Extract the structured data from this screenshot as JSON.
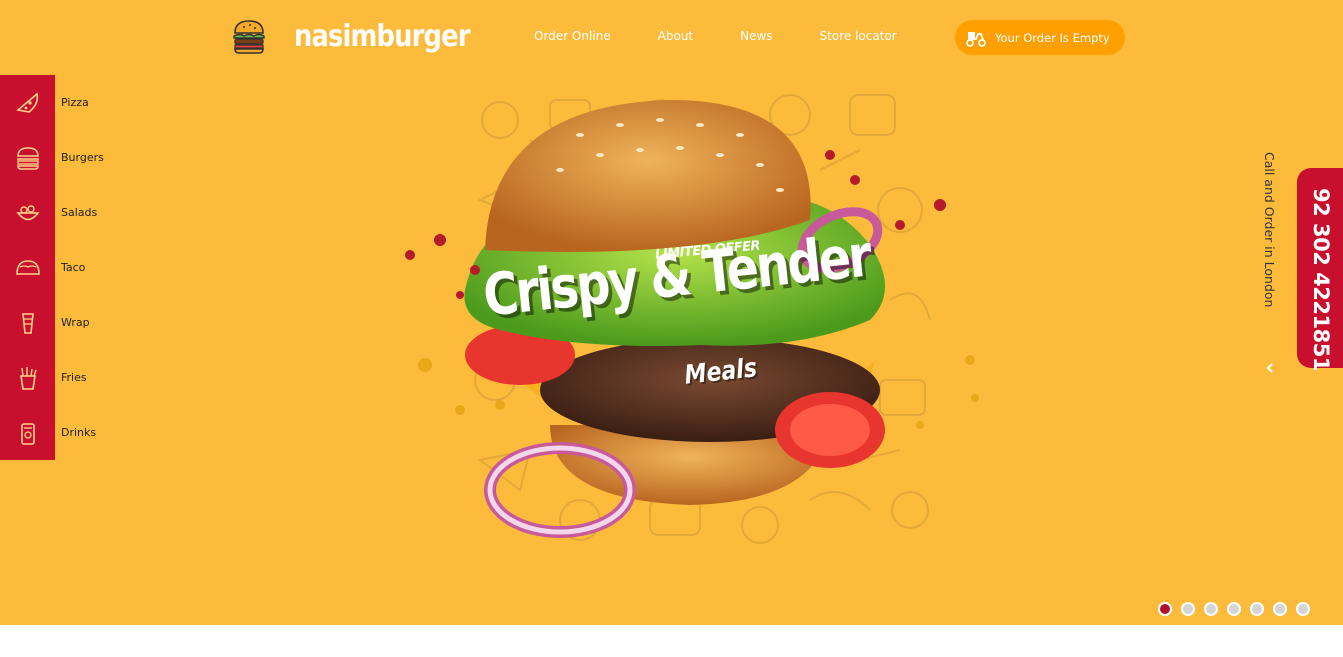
{
  "brand": {
    "name": "nasimburger",
    "logo_icon": "burger-icon"
  },
  "nav": [
    {
      "label": "Order Online"
    },
    {
      "label": "About"
    },
    {
      "label": "News"
    },
    {
      "label": "Store locator"
    }
  ],
  "cart": {
    "label": "Your Order Is Empty",
    "icon": "scooter-icon"
  },
  "categories": [
    {
      "label": "Pizza",
      "icon": "pizza-icon"
    },
    {
      "label": "Burgers",
      "icon": "burger-icon"
    },
    {
      "label": "Salads",
      "icon": "salad-icon"
    },
    {
      "label": "Taco",
      "icon": "taco-icon"
    },
    {
      "label": "Wrap",
      "icon": "wrap-icon"
    },
    {
      "label": "Fries",
      "icon": "fries-icon"
    },
    {
      "label": "Drinks",
      "icon": "drink-icon"
    }
  ],
  "hero": {
    "tag": "LIMITED OFFER",
    "title": "Crispy & Tender",
    "subtitle": "Meals"
  },
  "call": {
    "text": "Call and Order in  London",
    "phone": "92 302 4221851"
  },
  "slider": {
    "total": 7,
    "active_index": 0
  },
  "colors": {
    "background": "#fdbb3c",
    "accent": "#c8102e",
    "cart": "#ff9f00"
  }
}
